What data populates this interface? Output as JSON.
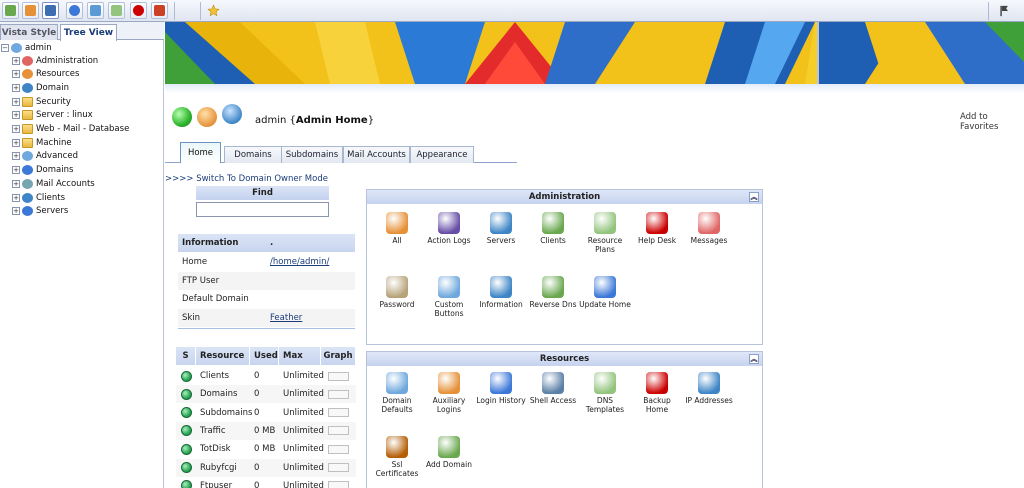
{
  "toolbar": {
    "buttons": [
      {
        "name": "home-icon",
        "color": "#6aa84f"
      },
      {
        "name": "users-icon",
        "color": "#e69138"
      },
      {
        "name": "bird-icon",
        "color": "#3d6eb4"
      },
      {
        "name": "globe-icon",
        "color": "#3c78d8"
      },
      {
        "name": "puzzle-icon",
        "color": "#5b9bd5"
      },
      {
        "name": "plugin-icon",
        "color": "#93c47d"
      },
      {
        "name": "person-icon",
        "color": "#cc0000"
      },
      {
        "name": "house-icon",
        "color": "#cc4125"
      },
      {
        "name": "star-icon",
        "color": "#f1c232"
      },
      {
        "name": "flag-icon",
        "color": "#444444"
      }
    ]
  },
  "left_tabs": {
    "vista": "Vista Style",
    "tree": "Tree View"
  },
  "tree": {
    "root": "admin",
    "items": [
      {
        "label": "Administration",
        "icon": "admin-icon",
        "color": "#e06666"
      },
      {
        "label": "Resources",
        "icon": "resources-icon",
        "color": "#e69138"
      },
      {
        "label": "Domain",
        "icon": "domain-icon",
        "color": "#3d85c6"
      },
      {
        "label": "Security",
        "icon": "folder-icon",
        "color": "#f1c232"
      },
      {
        "label": "Server  : linux",
        "icon": "folder-icon",
        "color": "#f1c232"
      },
      {
        "label": "Web - Mail - Database",
        "icon": "folder-icon",
        "color": "#f1c232"
      },
      {
        "label": "Machine",
        "icon": "folder-icon",
        "color": "#f1c232"
      },
      {
        "label": "Advanced",
        "icon": "advanced-icon",
        "color": "#6fa8dc"
      },
      {
        "label": "Domains",
        "icon": "domains-icon",
        "color": "#3c78d8"
      },
      {
        "label": "Mail Accounts",
        "icon": "mail-icon",
        "color": "#76a5af"
      },
      {
        "label": "Clients",
        "icon": "clients-icon",
        "color": "#3d85c6"
      },
      {
        "label": "Servers",
        "icon": "servers-icon",
        "color": "#3c78d8"
      }
    ]
  },
  "header": {
    "user": "admin",
    "title": "Admin Home",
    "add_favorites": "Add to Favorites"
  },
  "content_tabs": [
    "Home",
    "Domains",
    "Subdomains",
    "Mail Accounts",
    "Appearance"
  ],
  "switch_link": ">>>> Switch To Domain Owner Mode",
  "find": {
    "title": "Find",
    "value": ""
  },
  "info": {
    "headers": [
      "Information",
      "."
    ],
    "rows": [
      {
        "label": "Home",
        "value": "/home/admin/",
        "link": true
      },
      {
        "label": "FTP User",
        "value": "",
        "link": false
      },
      {
        "label": "Default Domain",
        "value": "",
        "link": false
      },
      {
        "label": "Skin",
        "value": "Feather",
        "link": true
      }
    ]
  },
  "resources_table": {
    "headers": [
      "S",
      "Resource",
      "Used",
      "Max",
      "Graph"
    ],
    "rows": [
      {
        "resource": "Clients",
        "used": "0",
        "max": "Unlimited"
      },
      {
        "resource": "Domains",
        "used": "0",
        "max": "Unlimited"
      },
      {
        "resource": "Subdomains",
        "used": "0",
        "max": "Unlimited"
      },
      {
        "resource": "Traffic",
        "used": "0 MB",
        "max": "Unlimited"
      },
      {
        "resource": "TotDisk",
        "used": "0 MB",
        "max": "Unlimited"
      },
      {
        "resource": "Rubyfcgi",
        "used": "0",
        "max": "Unlimited"
      },
      {
        "resource": "Ftpuser",
        "used": "0",
        "max": "Unlimited"
      }
    ]
  },
  "admin_panel": {
    "title": "Administration",
    "items": [
      {
        "label": "All",
        "icon": "tools-icon",
        "color": "#e69138"
      },
      {
        "label": "Action Logs",
        "icon": "gears-icon",
        "color": "#674ea7"
      },
      {
        "label": "Servers",
        "icon": "server-cube-icon",
        "color": "#3d85c6"
      },
      {
        "label": "Clients",
        "icon": "clients-icon",
        "color": "#6aa84f"
      },
      {
        "label": "Resource Plans",
        "icon": "plans-icon",
        "color": "#93c47d"
      },
      {
        "label": "Help Desk",
        "icon": "helpdesk-icon",
        "color": "#cc0000"
      },
      {
        "label": "Messages",
        "icon": "messages-icon",
        "color": "#e06666"
      },
      {
        "label": "Password",
        "icon": "key-icon",
        "color": "#b7a37a"
      },
      {
        "label": "Custom Buttons",
        "icon": "bubble-icon",
        "color": "#6fa8dc"
      },
      {
        "label": "Information",
        "icon": "info-icon",
        "color": "#3d85c6"
      },
      {
        "label": "Reverse Dns",
        "icon": "dns-icon",
        "color": "#6aa84f"
      },
      {
        "label": "Update Home",
        "icon": "update-icon",
        "color": "#3c78d8"
      }
    ]
  },
  "resources_panel": {
    "title": "Resources",
    "items": [
      {
        "label": "Domain Defaults",
        "icon": "bubble-icon",
        "color": "#6fa8dc"
      },
      {
        "label": "Auxiliary Logins",
        "icon": "users-icon",
        "color": "#e69138"
      },
      {
        "label": "Login History",
        "icon": "history-icon",
        "color": "#3c78d8"
      },
      {
        "label": "Shell Access",
        "icon": "shell-icon",
        "color": "#5b7fa6"
      },
      {
        "label": "DNS Templates",
        "icon": "templates-icon",
        "color": "#93c47d"
      },
      {
        "label": "Backup Home",
        "icon": "backup-icon",
        "color": "#cc0000"
      },
      {
        "label": "IP Addresses",
        "icon": "ip-icon",
        "color": "#3d85c6"
      },
      {
        "label": "Ssl Certificates",
        "icon": "certificate-icon",
        "color": "#b45f06"
      },
      {
        "label": "Add Domain",
        "icon": "add-domain-icon",
        "color": "#6aa84f"
      }
    ]
  }
}
